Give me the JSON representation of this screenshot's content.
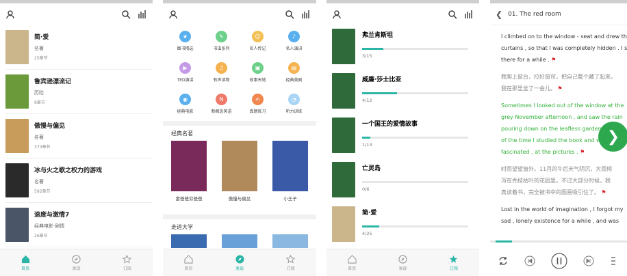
{
  "screen1": {
    "books": [
      {
        "title": "简·爱",
        "genre": "名著",
        "chapters": "25章节",
        "cover": "#cbb58a"
      },
      {
        "title": "鲁宾逊漂流记",
        "genre": "历险",
        "chapters": "9章节",
        "cover": "#6b9a3a"
      },
      {
        "title": "傲慢与偏见",
        "genre": "名著",
        "chapters": "370章节",
        "cover": "#c89c5a"
      },
      {
        "title": "冰与火之歌之权力的游戏",
        "genre": "名著",
        "chapters": "592章节",
        "cover": "#2a2a2a"
      },
      {
        "title": "速度与激情7",
        "genre": "经典电影·剧情",
        "chapters": "26章节",
        "cover": "#4a5568"
      }
    ],
    "tabs": [
      "首页",
      "发现",
      "订阅"
    ]
  },
  "screen2": {
    "categories": [
      {
        "label": "图书精选",
        "color": "#5ab0ee",
        "icon": "★"
      },
      {
        "label": "书虫系列",
        "color": "#6cd08a",
        "icon": "✎"
      },
      {
        "label": "名人传记",
        "color": "#f2c055",
        "icon": "☺"
      },
      {
        "label": "名人演讲",
        "color": "#5ab0ee",
        "icon": "♪"
      },
      {
        "label": "TED演讲",
        "color": "#c49ae8",
        "icon": "▶"
      },
      {
        "label": "有声读物",
        "color": "#f5b24e",
        "icon": "♫"
      },
      {
        "label": "故事天地",
        "color": "#6cd08a",
        "icon": "▣"
      },
      {
        "label": "经典美剧",
        "color": "#f5b24e",
        "icon": "▤"
      },
      {
        "label": "经典电影",
        "color": "#5ab0ee",
        "icon": "◉"
      },
      {
        "label": "新概念英语",
        "color": "#f07a6a",
        "icon": "N"
      },
      {
        "label": "真题练习",
        "color": "#f0874e",
        "icon": "✍"
      },
      {
        "label": "听力训练",
        "color": "#a8d4f5",
        "icon": "◔"
      }
    ],
    "section1_title": "经典名著",
    "classics": [
      {
        "label": "富爸爸穷爸爸",
        "color": "#7a2a5a"
      },
      {
        "label": "傲慢与偏见",
        "color": "#b08a5a"
      },
      {
        "label": "小王子",
        "color": "#3a5aa8"
      }
    ],
    "section2_title": "走进大学",
    "tabs": [
      "首页",
      "发现",
      "订阅"
    ]
  },
  "screen3": {
    "books": [
      {
        "title": "弗兰肯斯坦",
        "progress_text": "3/15",
        "progress": 0.2,
        "cover": "#2f6b3a"
      },
      {
        "title": "威廉·莎士比亚",
        "progress_text": "4/12",
        "progress": 0.33,
        "cover": "#2f6b3a"
      },
      {
        "title": "一个国王的爱情故事",
        "progress_text": "1/13",
        "progress": 0.08,
        "cover": "#2f6b3a"
      },
      {
        "title": "亡灵岛",
        "progress_text": "0/6",
        "progress": 0.0,
        "cover": "#2f6b3a"
      },
      {
        "title": "简·爱",
        "progress_text": "4/25",
        "progress": 0.16,
        "cover": "#cbb58a"
      }
    ],
    "tabs": [
      "首页",
      "发现",
      "订阅"
    ]
  },
  "screen4": {
    "chapter_title": "01. The red room",
    "paragraphs": [
      {
        "lines": [
          "I climbed on to the window - seat and drew the",
          "curtains , so that I was completely hidden . I sat",
          "there for a while ."
        ],
        "style": "en"
      },
      {
        "lines": [
          "我爬上窗台，拉好窗帘，把自己整个藏了起来。",
          "我在那里坐了一会儿。"
        ],
        "style": "cn"
      },
      {
        "lines": [
          "Sometimes I looked out of the window at the",
          "grey November afternoon , and saw the rain",
          "pouring down on the leafless garden . Most",
          "of the time I studied the book and was",
          "fascinated , at the pictures ."
        ],
        "style": "hl"
      },
      {
        "lines": [
          "时而望望窗外。11月的午后天气阴沉，大雨倾",
          "泻在秃枝枯叶的花园里。不过大部分时候，我",
          "真读着书，完全被书中的图画吸引住了。"
        ],
        "style": "cn"
      },
      {
        "lines": [
          "Lost in the world of imagination , I forgot my",
          "sad , lonely existence for a while , and was"
        ],
        "style": "en"
      }
    ],
    "progress": 0.12
  }
}
